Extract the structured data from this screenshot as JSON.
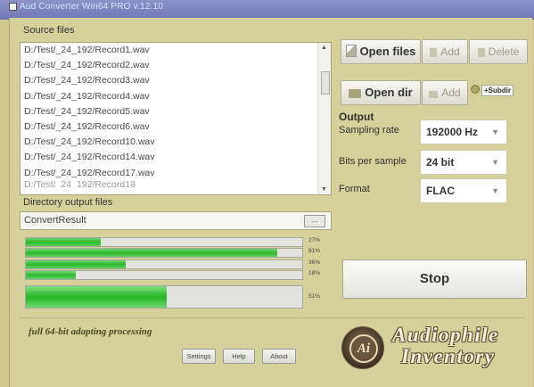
{
  "window": {
    "title": "Aud Converter Win64 PRO v.12.10"
  },
  "source": {
    "label": "Source files",
    "files": [
      "D:/Test/_24_192/Record1.wav",
      "D:/Test/_24_192/Record2.wav",
      "D:/Test/_24_192/Record3.wav",
      "D:/Test/_24_192/Record4.wav",
      "D:/Test/_24_192/Record5.wav",
      "D:/Test/_24_192/Record6.wav",
      "D:/Test/_24_192/Record10.wav",
      "D:/Test/_24_192/Record14.wav",
      "D:/Test/_24_192/Record17.wav",
      "D:/Test/_24_192/Record18"
    ]
  },
  "output_dir": {
    "label": "Directory output files",
    "value": "ConvertResult",
    "browse_label": "..."
  },
  "buttons": {
    "open_files": "Open files",
    "add_files": "Add",
    "delete": "Delete",
    "open_dir": "Open dir",
    "add_dir": "Add",
    "subdir": "+Subdir"
  },
  "output": {
    "title": "Output",
    "sampling_rate_label": "Sampling rate",
    "sampling_rate": "192000 Hz",
    "bits_label": "Bits per sample",
    "bits": "24 bit",
    "format_label": "Format",
    "format": "FLAC"
  },
  "progress": [
    {
      "label": "27%",
      "fraction": 0.27
    },
    {
      "label": "91%",
      "fraction": 0.91
    },
    {
      "label": "36%",
      "fraction": 0.36
    },
    {
      "label": "18%",
      "fraction": 0.18
    },
    {
      "label": "51%",
      "fraction": 0.51
    }
  ],
  "stop_label": "Stop",
  "footer": {
    "tagline": "full 64-bit adapting processing",
    "settings": "Settings",
    "help": "Help",
    "about": "About",
    "brand_line1": "Audiophile",
    "brand_line2": "Inventory"
  }
}
